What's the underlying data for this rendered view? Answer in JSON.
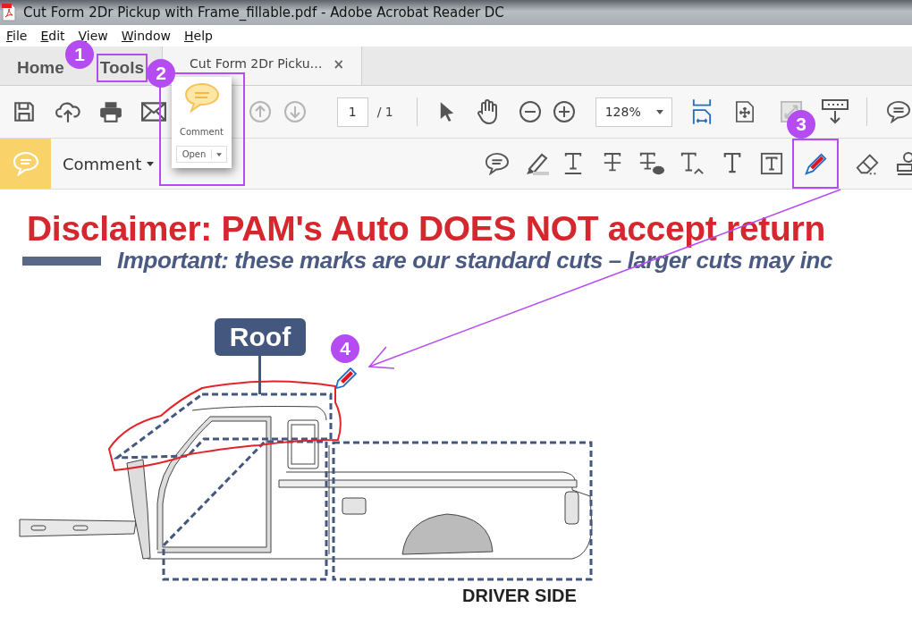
{
  "window": {
    "title": "Cut Form 2Dr Pickup with Frame_fillable.pdf - Adobe Acrobat Reader DC"
  },
  "menu": [
    {
      "label": "File"
    },
    {
      "label": "Edit"
    },
    {
      "label": "View"
    },
    {
      "label": "Window"
    },
    {
      "label": "Help"
    }
  ],
  "tabs": [
    {
      "label": "Home",
      "selected": false,
      "highlighted": false
    },
    {
      "label": "Tools",
      "selected": false,
      "highlighted": true
    },
    {
      "label": "Cut Form 2Dr Picku…",
      "selected": true,
      "highlighted": false,
      "close": "×"
    }
  ],
  "toolbar": {
    "page": "1",
    "page_total": "/ 1",
    "zoom": "128%"
  },
  "tools_popup": {
    "label": "Comment",
    "button": "Open"
  },
  "comment_bar": {
    "label": "Comment",
    "pencil_highlighted": true
  },
  "document": {
    "disclaimer": "Disclaimer: PAM's Auto DOES NOT accept return",
    "important": "Important: these marks are our standard cuts – larger cuts may inc",
    "roof_label": "Roof",
    "side_label": "DRIVER SIDE"
  },
  "callouts": [
    {
      "number": "1"
    },
    {
      "number": "2"
    },
    {
      "number": "3"
    },
    {
      "number": "4"
    }
  ]
}
